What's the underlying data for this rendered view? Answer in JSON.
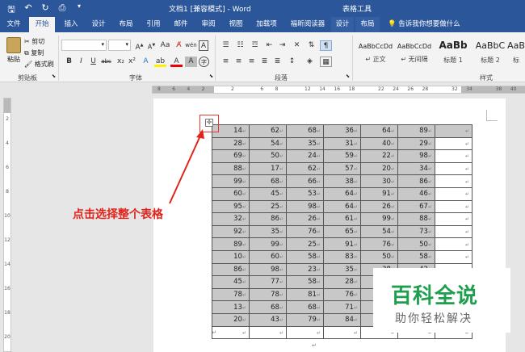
{
  "titlebar": {
    "document_title": "文档1 [兼容模式] - Word",
    "table_tools": "表格工具",
    "qat_icons": [
      "save-icon",
      "undo-icon",
      "redo-icon",
      "print-preview-icon",
      "customize-icon"
    ]
  },
  "tabs": [
    {
      "label": "文件"
    },
    {
      "label": "开始"
    },
    {
      "label": "插入"
    },
    {
      "label": "设计"
    },
    {
      "label": "布局"
    },
    {
      "label": "引用"
    },
    {
      "label": "邮件"
    },
    {
      "label": "审阅"
    },
    {
      "label": "视图"
    },
    {
      "label": "加载项"
    },
    {
      "label": "福昕阅读器"
    },
    {
      "label": "设计"
    },
    {
      "label": "布局"
    }
  ],
  "tell_me": "告诉我你想要做什么",
  "clipboard": {
    "paste": "粘贴",
    "cut": "剪切",
    "copy": "复制",
    "format_painter": "格式刷",
    "group": "剪贴板"
  },
  "font": {
    "group": "字体",
    "aa_grow": "Aa",
    "aa_shrink": "A",
    "bold": "B",
    "italic": "I",
    "underline": "U",
    "strike": "abc",
    "sub": "x₂",
    "sup": "x²",
    "font_color": "A",
    "highlight": "ab",
    "wen": "wén",
    "char_border": "A",
    "enclose": "字"
  },
  "paragraph": {
    "group": "段落"
  },
  "styles": {
    "group": "样式",
    "items": [
      {
        "preview": "AaBbCcDd",
        "name": "正文"
      },
      {
        "preview": "AaBbCcDd",
        "name": "无间隔"
      },
      {
        "preview": "AaBb",
        "name": "标题 1"
      },
      {
        "preview": "AaBbC",
        "name": "标题 2"
      },
      {
        "preview": "AaB",
        "name": "标"
      }
    ]
  },
  "ruler": {
    "h_numbers": [
      "8",
      "6",
      "4",
      "2",
      "",
      "2",
      "",
      "6",
      "8",
      "",
      "12",
      "14",
      "16",
      "18",
      "",
      "22",
      "24",
      "26",
      "28",
      "",
      "32",
      "34",
      "",
      "38",
      "40"
    ],
    "v_numbers": [
      "2",
      "4",
      "6",
      "8",
      "10",
      "12",
      "14",
      "16",
      "18",
      "20"
    ]
  },
  "table": {
    "rows": [
      [
        "14",
        "62",
        "68",
        "36",
        "64",
        "89",
        ""
      ],
      [
        "28",
        "54",
        "35",
        "31",
        "40",
        "29",
        ""
      ],
      [
        "69",
        "50",
        "24",
        "59",
        "22",
        "98",
        ""
      ],
      [
        "88",
        "17",
        "62",
        "57",
        "20",
        "34",
        ""
      ],
      [
        "99",
        "68",
        "66",
        "38",
        "30",
        "86",
        ""
      ],
      [
        "60",
        "45",
        "53",
        "64",
        "91",
        "46",
        ""
      ],
      [
        "95",
        "25",
        "98",
        "64",
        "26",
        "67",
        ""
      ],
      [
        "32",
        "86",
        "26",
        "61",
        "99",
        "88",
        ""
      ],
      [
        "92",
        "35",
        "76",
        "65",
        "54",
        "73",
        ""
      ],
      [
        "89",
        "99",
        "25",
        "91",
        "76",
        "50",
        ""
      ],
      [
        "10",
        "60",
        "58",
        "83",
        "50",
        "58",
        ""
      ],
      [
        "86",
        "98",
        "23",
        "35",
        "38",
        "42",
        ""
      ],
      [
        "45",
        "77",
        "58",
        "28",
        "",
        "",
        " "
      ],
      [
        "78",
        "78",
        "81",
        "76",
        "",
        "",
        " "
      ],
      [
        "13",
        "68",
        "68",
        "71",
        "",
        "",
        " "
      ],
      [
        "20",
        "43",
        "79",
        "84",
        "",
        "",
        " "
      ],
      [
        "",
        "",
        "",
        "",
        "",
        "",
        " "
      ]
    ]
  },
  "annotation": {
    "text": "点击选择整个表格",
    "color": "#e2231a"
  },
  "watermark": {
    "title": "百科全说",
    "subtitle": "助你轻松解决",
    "color": "#1f9e4e"
  },
  "colors": {
    "word_blue": "#2b579a",
    "selection_gray": "#c8c8c8"
  }
}
